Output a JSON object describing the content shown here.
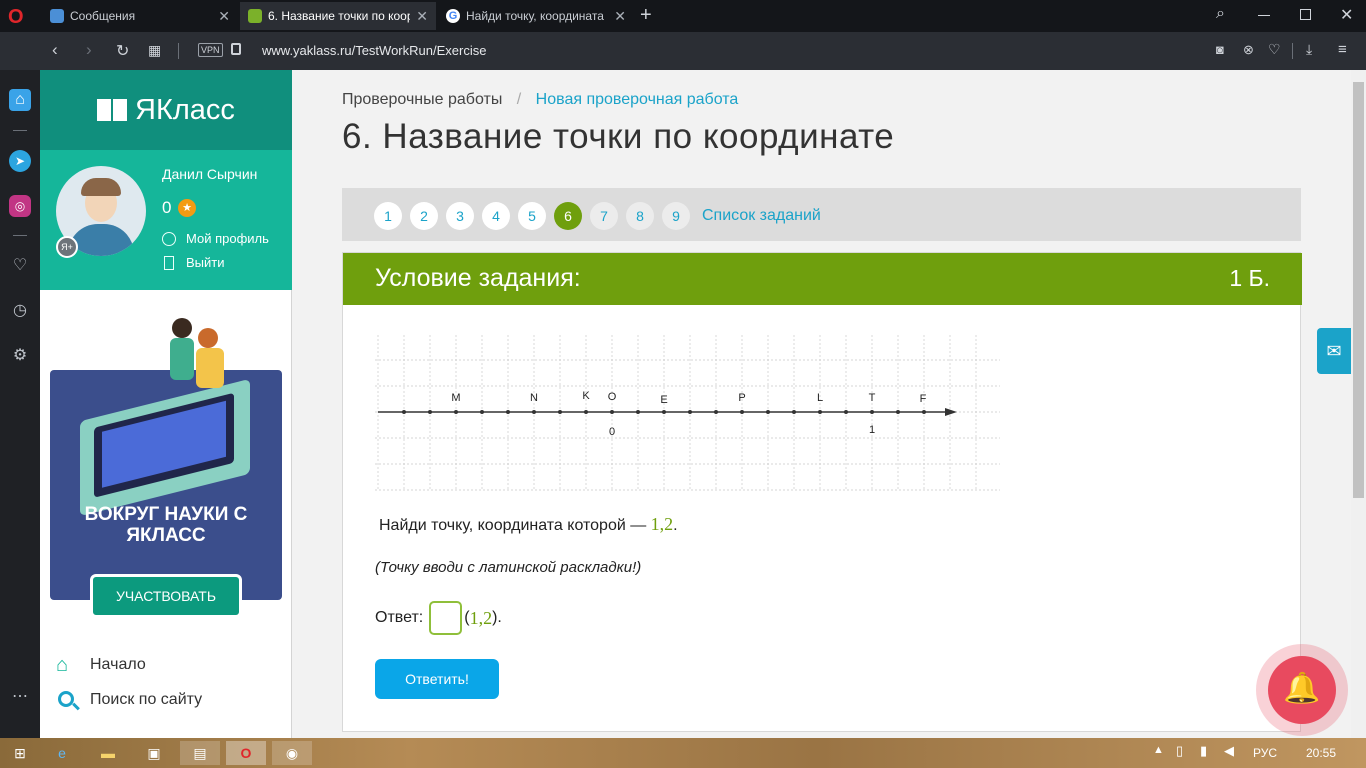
{
  "browser": {
    "tabs": [
      {
        "title": "Сообщения",
        "active": false
      },
      {
        "title": "6. Название точки по коор",
        "active": true
      },
      {
        "title": "Найди точку, координата",
        "active": false
      }
    ],
    "url": "www.yaklass.ru/TestWorkRun/Exercise",
    "vpn_label": "VPN"
  },
  "sidebar": {
    "logo_text": "ЯКласс",
    "user_name": "Данил Сырчин",
    "points": "0",
    "profile_link": "Мой профиль",
    "logout_link": "Выйти",
    "promo_title": "ВОКРУГ НАУКИ С ЯКЛАСС",
    "promo_button": "УЧАСТВОВАТЬ",
    "menu": [
      {
        "label": "Начало",
        "icon": "home-icon"
      },
      {
        "label": "Поиск по сайту",
        "icon": "search-icon"
      }
    ]
  },
  "header": {
    "breadcrumb_root": "Проверочные работы",
    "breadcrumb_sep": "/",
    "breadcrumb_current": "Новая проверочная работа",
    "title": "6. Название точки по координате"
  },
  "pager": {
    "items": [
      "1",
      "2",
      "3",
      "4",
      "5",
      "6",
      "7",
      "8",
      "9"
    ],
    "current": "6",
    "list_link": "Список заданий"
  },
  "task": {
    "header": "Условие задания:",
    "score": "1 Б.",
    "number_line": {
      "labels": [
        "M",
        "N",
        "K",
        "O",
        "E",
        "P",
        "L",
        "T",
        "F"
      ],
      "tick_zero": "0",
      "tick_one": "1"
    },
    "question_prefix": "Найди точку, координата которой —",
    "question_value": "1,2",
    "question_suffix": ".",
    "hint": "(Точку вводи с латинской раскладки!)",
    "answer_label": "Ответ:",
    "answer_value": "",
    "answer_suffix_open": "(",
    "answer_coord": "1,2",
    "answer_suffix_close": ").",
    "submit_label": "Ответить!"
  },
  "taskbar": {
    "lang": "РУС",
    "time": "20:55"
  },
  "colors": {
    "teal": "#15b69a",
    "green": "#6f9f0d",
    "link": "#1ba3c9",
    "button": "#0aa6e8"
  }
}
